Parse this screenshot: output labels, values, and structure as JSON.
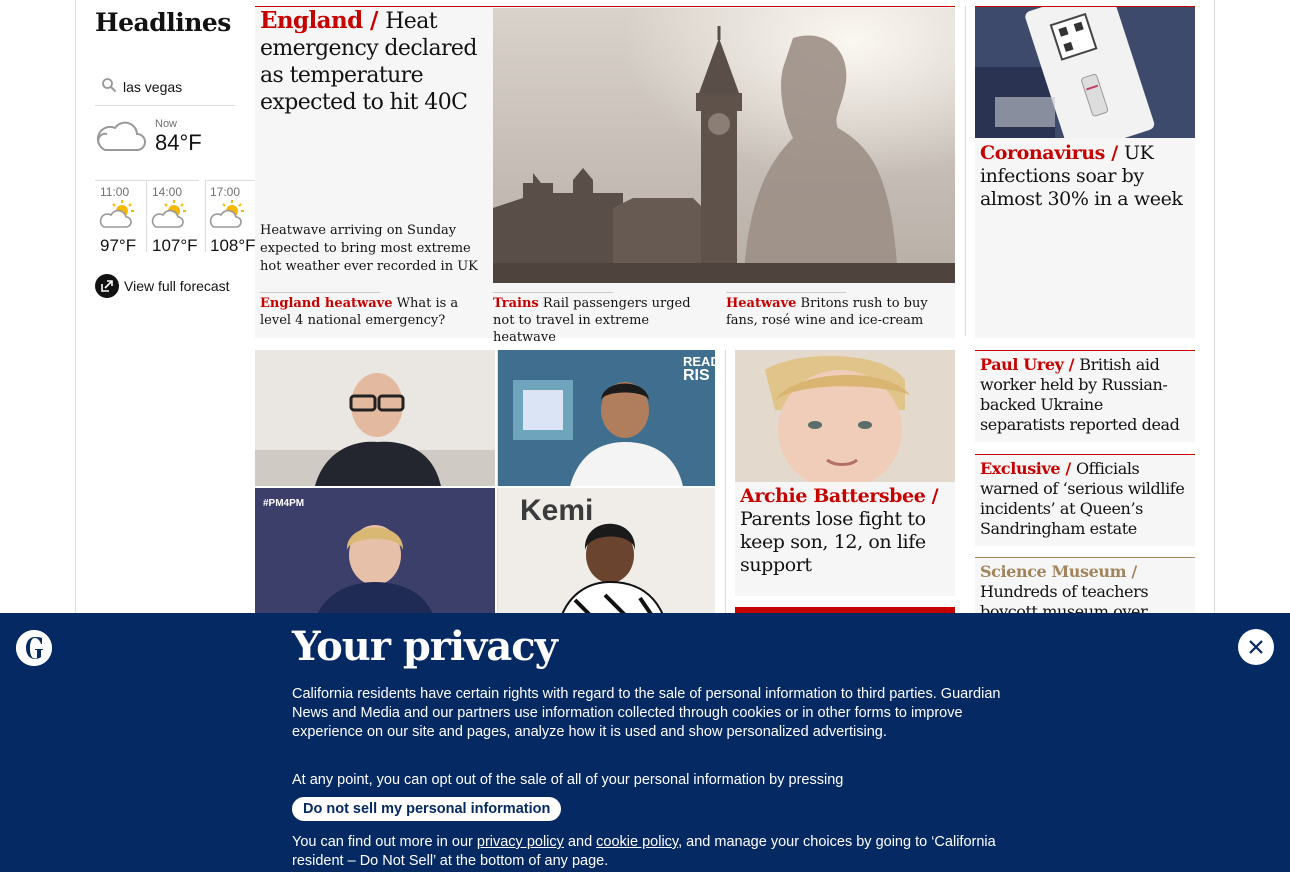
{
  "rail": {
    "title": "Headlines",
    "search_location": "las vegas",
    "now_label": "Now",
    "now_temp": "84°F",
    "forecast": [
      {
        "time": "11:00",
        "temp": "97°F"
      },
      {
        "time": "14:00",
        "temp": "107°F"
      },
      {
        "time": "17:00",
        "temp": "108°F"
      }
    ],
    "full_forecast": "View full forecast"
  },
  "hero": {
    "kicker": "England / ",
    "headline": "Heat emergency declared as temperature expected to hit 40C",
    "standfirst": "Heatwave arriving on Sunday expected to bring most extreme hot weather ever recorded in UK",
    "sublinks": [
      {
        "kicker": "England heatwave",
        "text": " What is a level 4 national emergency?"
      },
      {
        "kicker": "Trains",
        "text": " Rail passengers urged not to travel in extreme heatwave"
      },
      {
        "kicker": "Heatwave",
        "text": " Britons rush to buy fans, rosé wine and ice-cream"
      }
    ]
  },
  "right_column": [
    {
      "kicker": "Coronavirus / ",
      "headline": "UK infections soar by almost 30% in a week"
    },
    {
      "kicker": "Paul Urey / ",
      "headline": "British aid worker held by Russian-backed Ukraine separatists reported dead"
    },
    {
      "kicker": "Exclusive / ",
      "headline": "Officials warned of ‘serious wildlife incidents’ at Queen’s Sandringham estate"
    },
    {
      "kicker": "Science Museum / ",
      "headline": "Hundreds of teachers boycott museum over"
    }
  ],
  "archie": {
    "kicker": "Archie Battersbee / ",
    "headline": "Parents lose fight to keep son, 12, on life support"
  },
  "privacy": {
    "title": "Your privacy",
    "para1": "California residents have certain rights with regard to the sale of personal information to third parties. Guardian News and Media and our partners use information collected through cookies or in other forms to improve experience on our site and pages, analyze how it is used and show personalized advertising.",
    "para2": "At any point, you can opt out of the sale of all of your personal information by pressing",
    "button": "Do not sell my personal information",
    "para3_a": "You can find out more in our ",
    "privacy_link": "privacy policy",
    "para3_b": " and ",
    "cookie_link": "cookie policy",
    "para3_c": ", and manage your choices by going to ‘California resident – Do Not Sell’ at the bottom of any page."
  },
  "colors": {
    "brand_red": "#c70000",
    "brand_blue": "#052962"
  }
}
